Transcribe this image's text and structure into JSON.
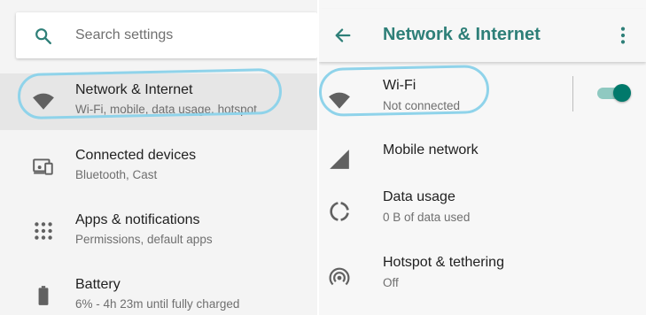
{
  "colors": {
    "accent": "#2e7f78",
    "toggle_on": "#00796b",
    "highlight": "#8fd3ea",
    "selected_row": "#e6e6e6"
  },
  "search": {
    "placeholder": "Search settings",
    "icon": "search-icon"
  },
  "settings_list": [
    {
      "title": "Network & Internet",
      "subtitle": "Wi-Fi, mobile, data usage, hotspot",
      "icon": "wifi-icon",
      "selected": true
    },
    {
      "title": "Connected devices",
      "subtitle": "Bluetooth, Cast",
      "icon": "devices-icon"
    },
    {
      "title": "Apps & notifications",
      "subtitle": "Permissions, default apps",
      "icon": "apps-grid-icon"
    },
    {
      "title": "Battery",
      "subtitle": "6% - 4h 23m until fully charged",
      "icon": "battery-icon"
    }
  ],
  "network_screen": {
    "title": "Network & Internet",
    "back_icon": "back-arrow-icon",
    "menu_icon": "more-vert-icon",
    "items": [
      {
        "title": "Wi-Fi",
        "subtitle": "Not connected",
        "icon": "wifi-icon",
        "toggle_on": true
      },
      {
        "title": "Mobile network",
        "subtitle": "",
        "icon": "signal-icon"
      },
      {
        "title": "Data usage",
        "subtitle": "0 B of data used",
        "icon": "data-usage-icon"
      },
      {
        "title": "Hotspot & tethering",
        "subtitle": "Off",
        "icon": "hotspot-icon"
      }
    ]
  }
}
